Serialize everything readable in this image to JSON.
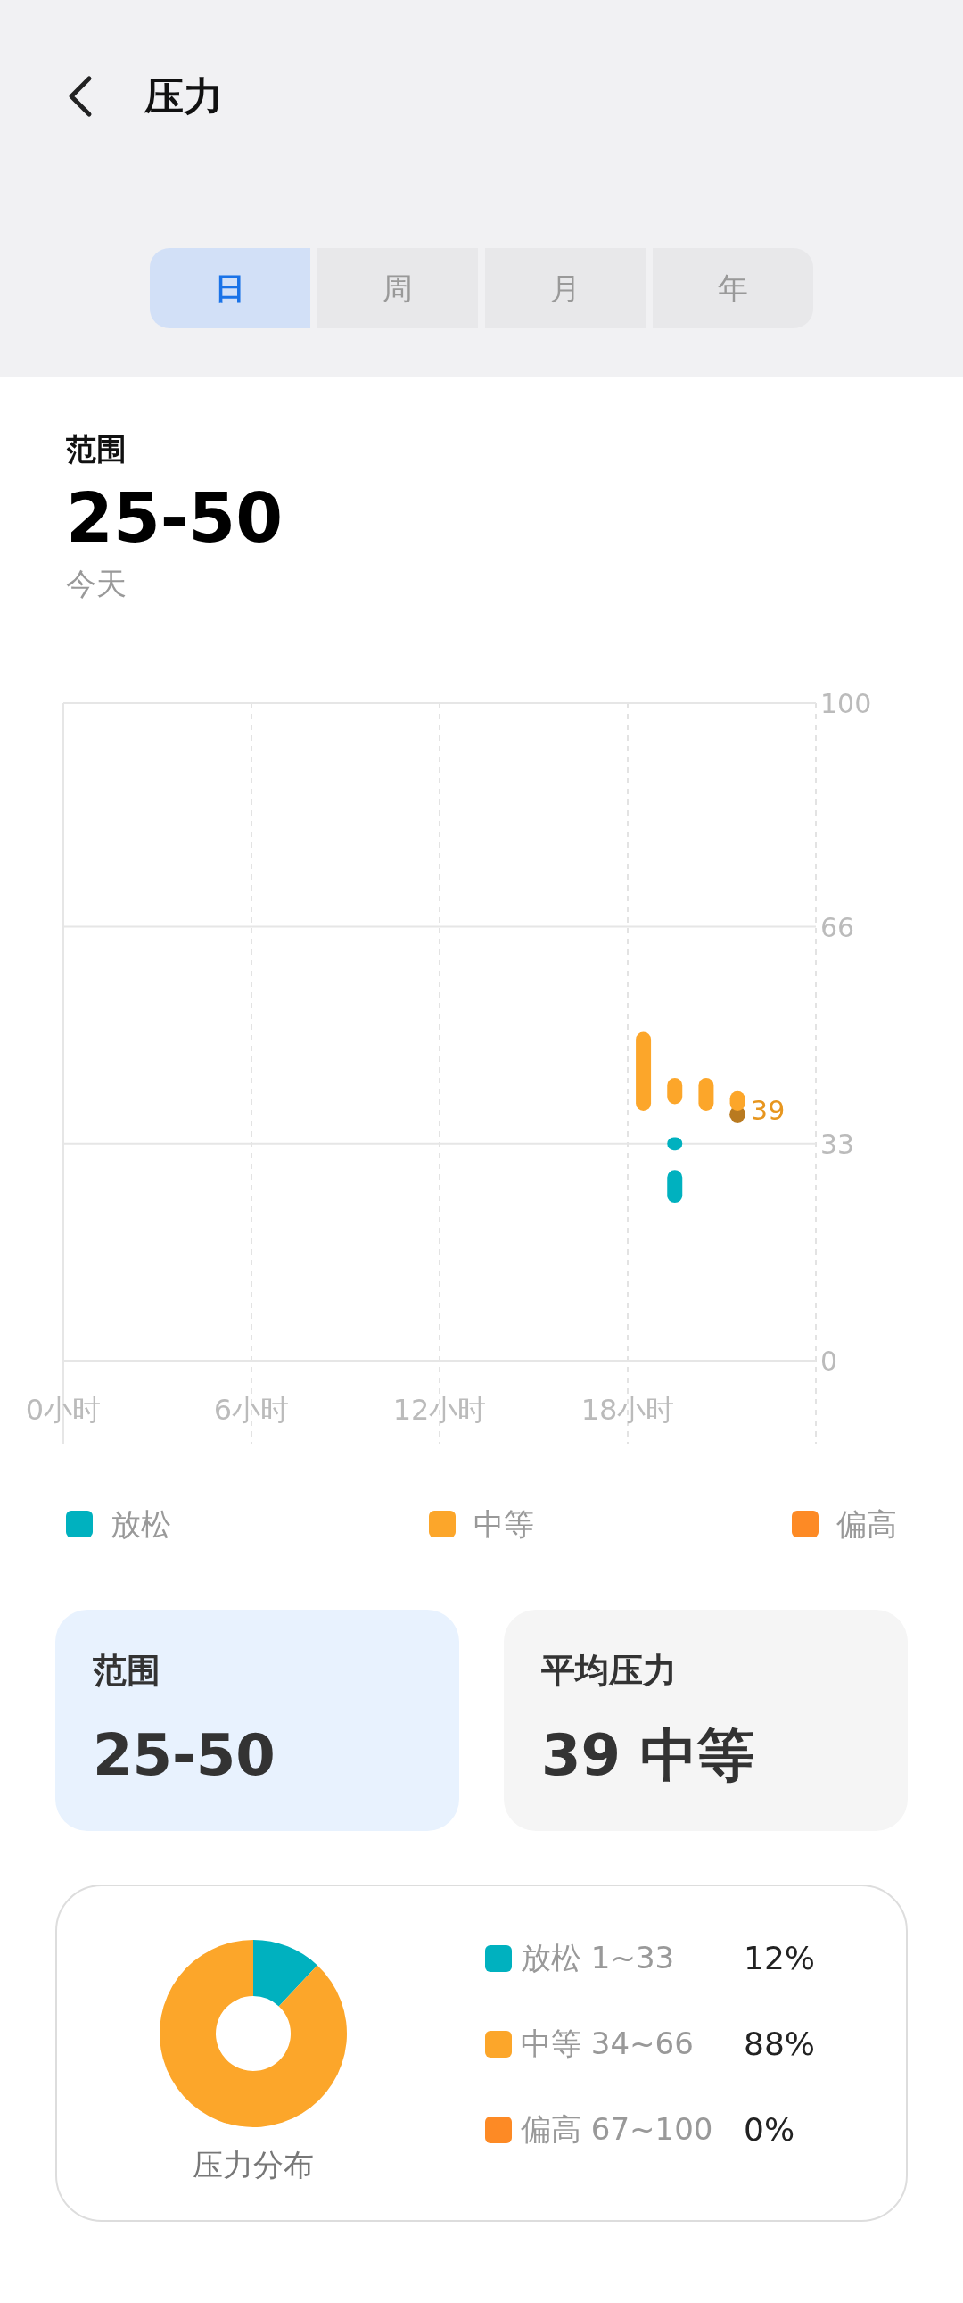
{
  "header": {
    "title": "压力"
  },
  "tabs": [
    {
      "label": "日",
      "selected": true
    },
    {
      "label": "周",
      "selected": false
    },
    {
      "label": "月",
      "selected": false
    },
    {
      "label": "年",
      "selected": false
    }
  ],
  "summary": {
    "label": "范围",
    "value": "25-50",
    "date": "今天"
  },
  "chart": {
    "chart_data": {
      "type": "candlestick",
      "xlim": [
        0,
        24
      ],
      "ylim": [
        0,
        100
      ],
      "xticks": [
        {
          "value": 0,
          "label": "0小时"
        },
        {
          "value": 6,
          "label": "6小时"
        },
        {
          "value": 12,
          "label": "12小时"
        },
        {
          "value": 18,
          "label": "18小时"
        }
      ],
      "yticks": [
        0,
        33,
        66,
        100
      ],
      "grid": true,
      "series": [
        {
          "name": "放松",
          "color": "#00b1bf",
          "x": [
            19.5,
            19.5
          ],
          "ohlc": [
            [
              32,
              34,
              32,
              34
            ],
            [
              24,
              29,
              24,
              29
            ]
          ]
        },
        {
          "name": "中等",
          "color": "#fca62a",
          "x": [
            18.5,
            19.5,
            20.5,
            21.5
          ],
          "ohlc": [
            [
              38,
              50,
              38,
              50
            ],
            [
              39,
              43,
              39,
              43
            ],
            [
              38,
              43,
              38,
              43
            ],
            [
              38,
              41,
              38,
              41
            ]
          ]
        },
        {
          "name": "偏高",
          "color": "#fd8a25"
        }
      ],
      "annotations": [
        "39"
      ]
    }
  },
  "cards": [
    {
      "label": "范围",
      "value": "25-50",
      "selected": true
    },
    {
      "label": "平均压力",
      "value": "39 中等",
      "selected": false
    }
  ],
  "distribution": {
    "title": "压力分布",
    "chart_data": {
      "type": "donut",
      "categories": [
        "放松",
        "中等",
        "偏高"
      ],
      "values": [
        12,
        88,
        0
      ]
    },
    "items": [
      {
        "range": "1~33",
        "percent": "12%",
        "color": "#00b1bf"
      },
      {
        "range": "34~66",
        "percent": "88%",
        "color": "#fca62a"
      },
      {
        "range": "67~100",
        "percent": "0%",
        "color": "#fd8a25"
      }
    ]
  }
}
